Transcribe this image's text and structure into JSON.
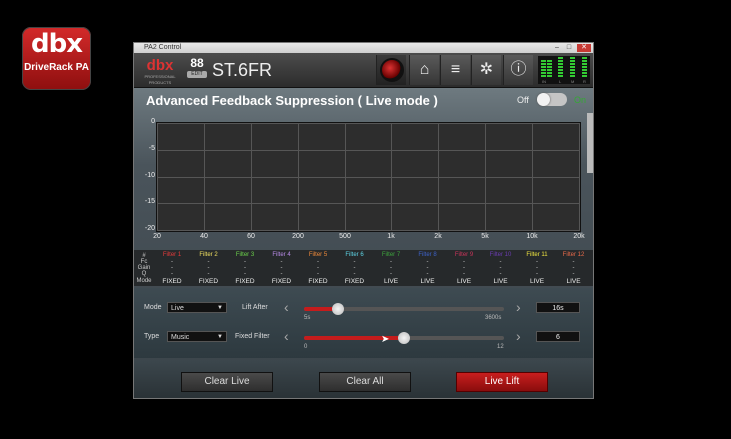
{
  "desktop": {
    "logo_brand": "dbx",
    "logo_sub": "DriveRack PA"
  },
  "window": {
    "title": "PA2 Control",
    "btn_min": "–",
    "btn_max": "□",
    "btn_close": "✕"
  },
  "header": {
    "brand": "dbx",
    "brand_tag": "PROFESSIONAL PRODUCTS",
    "preset_number": "88",
    "preset_edit": "EDIT",
    "preset_name": "ST.6FR",
    "icons": [
      "knob-icon",
      "home-icon",
      "list-icon",
      "gear-icon",
      "info-icon"
    ],
    "home_glyph": "⌂",
    "list_glyph": "≡",
    "gear_glyph": "✲",
    "info_glyph": "ⓘ",
    "meter_labels": [
      "IN",
      "L",
      "M",
      "R"
    ]
  },
  "panel": {
    "title": "Advanced Feedback Suppression ( Live mode )",
    "toggle_off": "Off",
    "toggle_on": "On",
    "toggle_state": "off"
  },
  "chart_data": {
    "type": "line",
    "y_ticks": [
      "0",
      "-5",
      "-10",
      "-15",
      "-20"
    ],
    "x_ticks": [
      "20",
      "40",
      "60",
      "200",
      "500",
      "1k",
      "2k",
      "5k",
      "10k",
      "20k"
    ],
    "x_scale": "log",
    "ylim": [
      -20,
      0
    ],
    "grid": true,
    "series": []
  },
  "filters": {
    "row_labels": [
      "#",
      "Fc",
      "Gain",
      "Q",
      "Mode"
    ],
    "placeholder": "-",
    "items": [
      {
        "name": "Filter 1",
        "mode": "FIXED",
        "color": "#e33b3b"
      },
      {
        "name": "Filter 2",
        "mode": "FIXED",
        "color": "#f0e060"
      },
      {
        "name": "Filter 3",
        "mode": "FIXED",
        "color": "#6bd24b"
      },
      {
        "name": "Filter 4",
        "mode": "FIXED",
        "color": "#b98ce8"
      },
      {
        "name": "Filter 5",
        "mode": "FIXED",
        "color": "#f08a3a"
      },
      {
        "name": "Filter 6",
        "mode": "FIXED",
        "color": "#5ed6e8"
      },
      {
        "name": "Filter 7",
        "mode": "LIVE",
        "color": "#3da23d"
      },
      {
        "name": "Filter 8",
        "mode": "LIVE",
        "color": "#3d62c8"
      },
      {
        "name": "Filter 9",
        "mode": "LIVE",
        "color": "#c8345a"
      },
      {
        "name": "Filter 10",
        "mode": "LIVE",
        "color": "#6a3cb0"
      },
      {
        "name": "Filter 11",
        "mode": "LIVE",
        "color": "#f2e840"
      },
      {
        "name": "Filter 12",
        "mode": "LIVE",
        "color": "#e86a4a"
      }
    ]
  },
  "controls": {
    "mode_label": "Mode",
    "mode_value": "Live",
    "type_label": "Type",
    "type_value": "Music",
    "lift_label": "Lift After",
    "lift_min": "5s",
    "lift_max": "3600s",
    "lift_value": "16s",
    "lift_fraction": 0.17,
    "fixed_label": "Fixed Filter",
    "fixed_min": "0",
    "fixed_max": "12",
    "fixed_value": "6",
    "fixed_fraction": 0.5,
    "chev_left": "‹",
    "chev_right": "›",
    "sel_arrow": "▼"
  },
  "buttons": {
    "clear_live": "Clear Live",
    "clear_all": "Clear All",
    "live_lift": "Live Lift"
  }
}
